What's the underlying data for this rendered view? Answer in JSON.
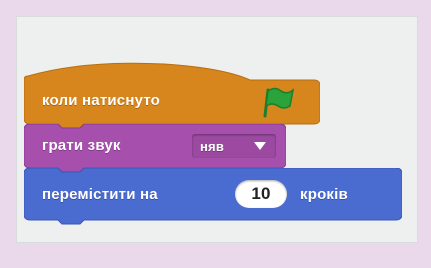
{
  "blocks": {
    "hat": {
      "label": "коли натиснуто",
      "icon": "green-flag-icon",
      "color": "#d6861c"
    },
    "sound": {
      "label": "грати звук",
      "selected": "няв",
      "color": "#a64fad"
    },
    "motion": {
      "label": "перемістити на",
      "value": "10",
      "unit": "кроків",
      "color": "#4a6cd0"
    }
  },
  "colors": {
    "background": "#ead9ea",
    "panel": "#eef0f0",
    "flag": "#2aa33a"
  }
}
